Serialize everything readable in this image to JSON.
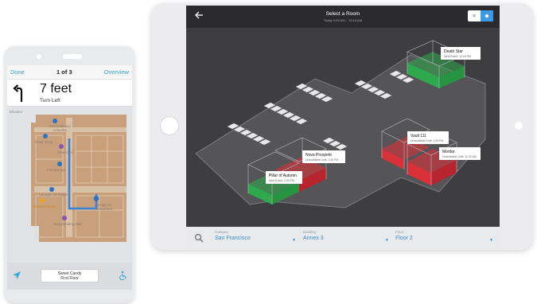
{
  "phone": {
    "nav": {
      "done": "Done",
      "step": "1 of 3",
      "overview": "Overview"
    },
    "turn": {
      "distance": "7 feet",
      "direction": "Turn Left"
    },
    "map": {
      "label": "Elevator",
      "pois": [
        {
          "name": "Unconditional Artworks"
        },
        {
          "name": "Front Desk"
        },
        {
          "name": "Pinocchio"
        },
        {
          "name": "Fire Escape"
        },
        {
          "name": "Lounge Honeypot"
        },
        {
          "name": "Sweet Candy"
        },
        {
          "name": "Temple of Atonement"
        },
        {
          "name": "Kingslanding Hall"
        }
      ]
    },
    "floor_box": {
      "line1": "Sweet Candy",
      "line2": "First Floor"
    }
  },
  "tablet": {
    "title": "Select a Room",
    "subtitle": "Today 9:45 AM – 10:15 AM",
    "rooms": [
      {
        "name": "Death Star",
        "status": "Next Event: 12:00 PM",
        "state": "available"
      },
      {
        "name": "Vault 111",
        "status": "Unavailable Until: 2:30 PM",
        "state": "unavailable"
      },
      {
        "name": "Mordor",
        "status": "Unavailable Until: 11:00 AM",
        "state": "unavailable"
      },
      {
        "name": "Nova Prospekt",
        "status": "Unavailable Until: 1:30 PM",
        "state": "unavailable"
      },
      {
        "name": "Pillar of Autumn",
        "status": "Next Event: 2:00 PM",
        "state": "available"
      }
    ],
    "filters": {
      "campus": {
        "label": "Campus",
        "value": "San Francisco"
      },
      "building": {
        "label": "Building",
        "value": "Annex 3"
      },
      "floor": {
        "label": "Floor",
        "value": "Floor 2"
      }
    },
    "colors": {
      "available": "#2ea94d",
      "unavailable": "#d9303a",
      "accent": "#3d99e3"
    }
  }
}
